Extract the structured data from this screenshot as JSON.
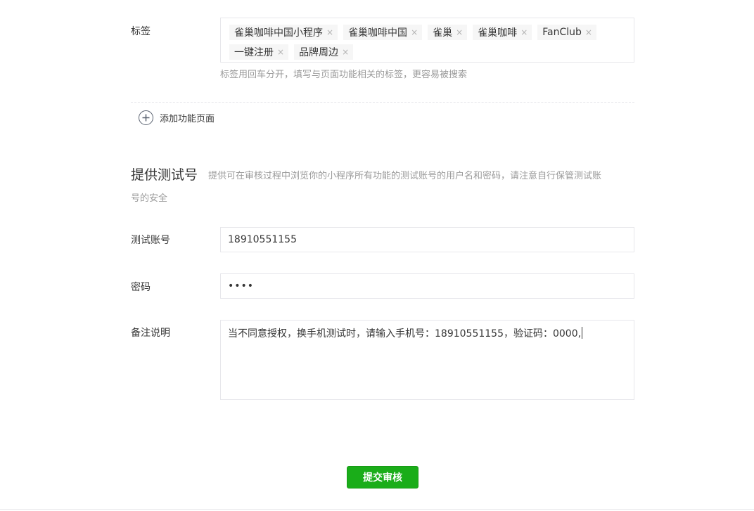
{
  "tags": {
    "label": "标签",
    "row1": [
      "雀巢咖啡中国小程序",
      "雀巢咖啡中国",
      "雀巢",
      "雀巢咖啡",
      "FanClub"
    ],
    "row2": [
      "一键注册",
      "品牌周边"
    ],
    "remove_glyph": "×",
    "tip": "标签用回车分开，填写与页面功能相关的标签，更容易被搜索"
  },
  "add_page": {
    "label": "添加功能页面",
    "icon": "plus-circle-icon"
  },
  "test_account_section": {
    "title": "提供测试号",
    "description_line1": "提供可在审核过程中浏览你的小程序所有功能的测试账号的用户名和密码，请注意自行保管测试账",
    "description_line2": "号的安全"
  },
  "account": {
    "label": "测试账号",
    "value": "18910551155"
  },
  "password": {
    "label": "密码",
    "value": "••••"
  },
  "remarks": {
    "label": "备注说明",
    "value": "当不同意授权，换手机测试时，请输入手机号：18910551155，验证码：0000,"
  },
  "submit": {
    "label": "提交审核",
    "color": "#1aad19"
  }
}
